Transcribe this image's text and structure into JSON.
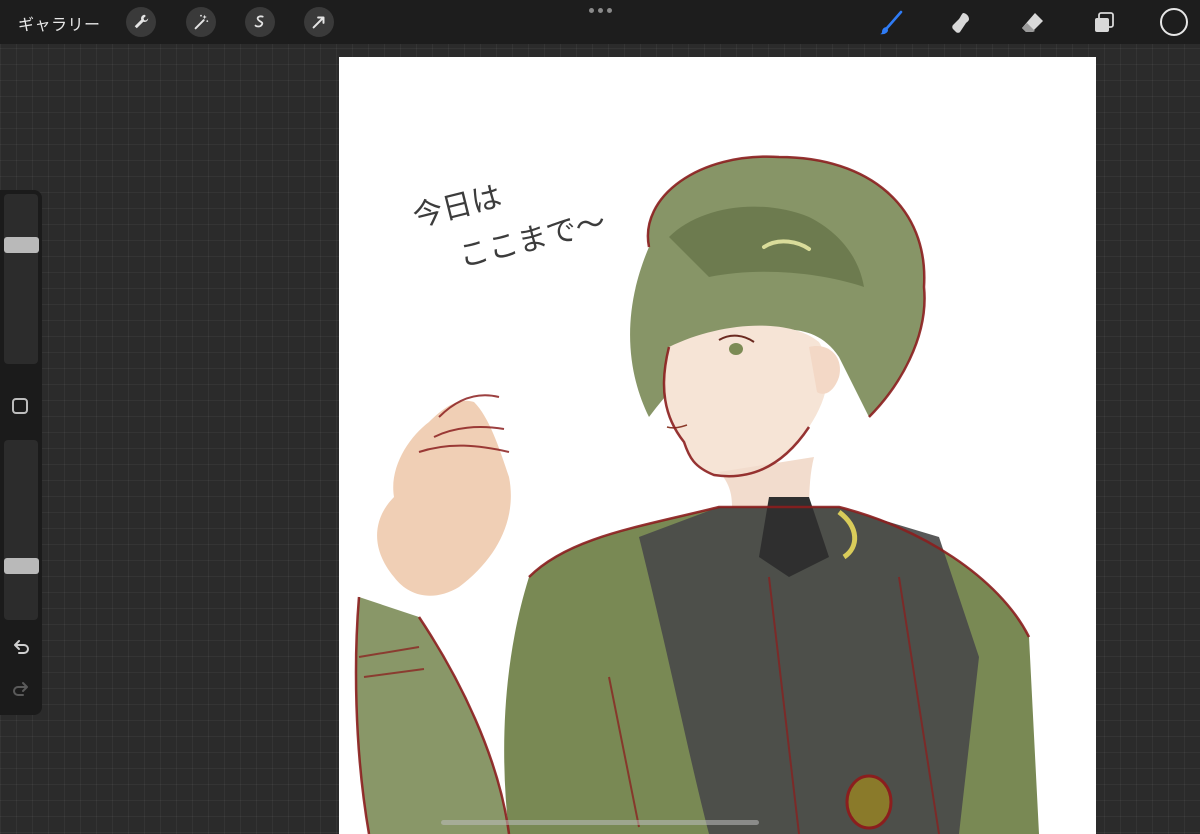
{
  "toolbar": {
    "gallery_label": "ギャラリー",
    "left_tools": [
      "wrench-icon",
      "magic-wand-icon",
      "selection-icon",
      "transform-arrow-icon"
    ],
    "right_tools": [
      "brush-icon",
      "smudge-icon",
      "eraser-icon",
      "layers-icon"
    ],
    "active_tool": "brush",
    "accent_color": "#2f7cf6",
    "current_color": "#1d1d1d"
  },
  "sidebar": {
    "brush_size_level": 0.72,
    "opacity_level": 0.28,
    "controls": [
      "modify-button",
      "undo-icon",
      "redo-icon"
    ]
  },
  "canvas": {
    "handwritten_note": [
      "今日は",
      "ここまで〜"
    ],
    "background": "#ffffff",
    "hair_color": "#6f7f4e",
    "uniform_color": "#6e7f45",
    "line_color": "#8b1e1e",
    "shirt_color": "#4a4a4a"
  }
}
